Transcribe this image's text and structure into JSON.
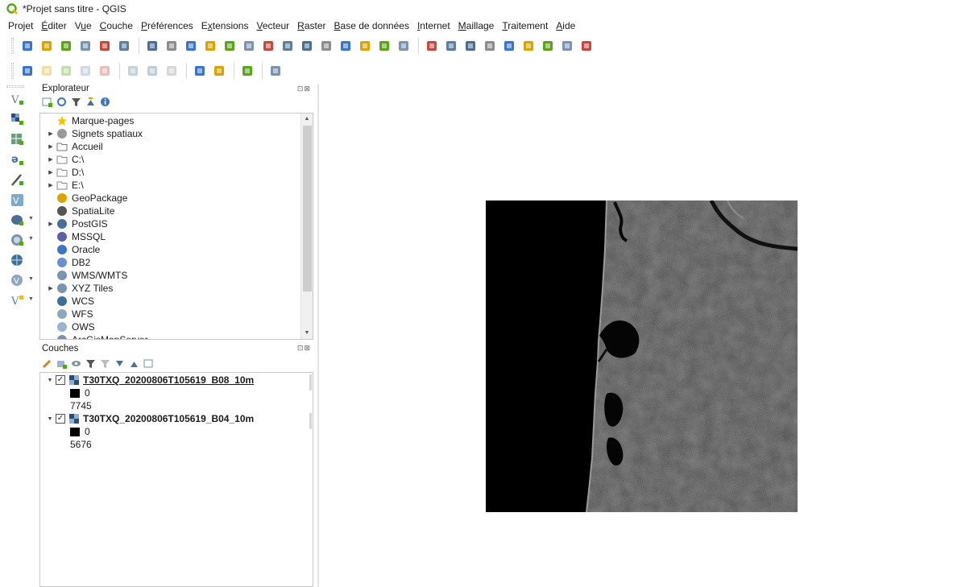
{
  "window": {
    "title": "*Projet sans titre - QGIS"
  },
  "menu": [
    {
      "u": "",
      "rest": "Projet"
    },
    {
      "u": "É",
      "rest": "diter"
    },
    {
      "u": "",
      "rest": "V",
      "u2": "u",
      "rest2": "e"
    },
    {
      "u": "C",
      "rest": "ouche"
    },
    {
      "u": "P",
      "rest": "références"
    },
    {
      "u": "",
      "rest": "E",
      "u2": "x",
      "rest2": "tensions"
    },
    {
      "u": "V",
      "rest": "ecteur"
    },
    {
      "u": "R",
      "rest": "aster"
    },
    {
      "u": "B",
      "rest": "ase de données"
    },
    {
      "u": "I",
      "rest": "nternet"
    },
    {
      "u": "M",
      "rest": "aillage"
    },
    {
      "u": "T",
      "rest": "raitement"
    },
    {
      "u": "A",
      "rest": "ide"
    }
  ],
  "toolbar1_icons": [
    "new-project-icon",
    "open-project-icon",
    "save-project-icon",
    "save-as-icon",
    "new-print-layout-icon",
    "style-manager-icon",
    "pan-icon",
    "pan-to-selection-icon",
    "zoom-in-icon",
    "zoom-out-icon",
    "zoom-full-icon",
    "zoom-to-selection-icon",
    "zoom-to-layer-icon",
    "zoom-native-icon",
    "zoom-last-icon",
    "zoom-next-icon",
    "new-bookmark-icon",
    "show-bookmarks-icon",
    "new-map-view-icon",
    "refresh-icon",
    "identify-icon",
    "select-icon",
    "deselect-icon",
    "open-attribute-table-icon",
    "field-calculator-icon",
    "statistics-icon",
    "measure-icon",
    "annotation-icon",
    "text-annotation-icon"
  ],
  "toolbar2_icons": [
    "digitize-icon",
    "edit-icon",
    "add-point-icon",
    "add-line-icon",
    "add-polygon-icon",
    "save-edits-icon",
    "undo-icon",
    "redo-icon",
    "label-icon",
    "diagram-icon",
    "python-icon",
    "help-icon"
  ],
  "explorer": {
    "title": "Explorateur",
    "controls": "⊡⊠",
    "items": [
      {
        "label": "Marque-pages",
        "icon": "star-icon",
        "expandable": false
      },
      {
        "label": "Signets spatiaux",
        "icon": "spatial-bookmarks-icon",
        "expandable": true
      },
      {
        "label": "Accueil",
        "icon": "home-folder-icon",
        "expandable": true
      },
      {
        "label": "C:\\",
        "icon": "folder-icon",
        "expandable": true
      },
      {
        "label": "D:\\",
        "icon": "folder-icon",
        "expandable": true
      },
      {
        "label": "E:\\",
        "icon": "folder-icon",
        "expandable": true
      },
      {
        "label": "GeoPackage",
        "icon": "geopackage-icon",
        "expandable": false
      },
      {
        "label": "SpatiaLite",
        "icon": "spatialite-icon",
        "expandable": false
      },
      {
        "label": "PostGIS",
        "icon": "postgis-icon",
        "expandable": true
      },
      {
        "label": "MSSQL",
        "icon": "mssql-icon",
        "expandable": false
      },
      {
        "label": "Oracle",
        "icon": "oracle-icon",
        "expandable": false
      },
      {
        "label": "DB2",
        "icon": "db2-icon",
        "expandable": false
      },
      {
        "label": "WMS/WMTS",
        "icon": "wms-icon",
        "expandable": false
      },
      {
        "label": "XYZ Tiles",
        "icon": "xyz-tiles-icon",
        "expandable": true
      },
      {
        "label": "WCS",
        "icon": "wcs-icon",
        "expandable": false
      },
      {
        "label": "WFS",
        "icon": "wfs-icon",
        "expandable": false
      },
      {
        "label": "OWS",
        "icon": "ows-icon",
        "expandable": false
      },
      {
        "label": "ArcGisMapServer",
        "icon": "arcgis-icon",
        "expandable": false
      }
    ]
  },
  "layers": {
    "title": "Couches",
    "controls": "⊡⊠",
    "items": [
      {
        "name": "T30TXQ_20200806T105619_B08_10m",
        "checked": "✓",
        "min": "0",
        "max": "7745"
      },
      {
        "name": "T30TXQ_20200806T105619_B04_10m",
        "checked": "✓",
        "min": "0",
        "max": "5676"
      }
    ]
  },
  "colors": {
    "qgis_green": "#58a51b",
    "toolbar_blue": "#3a76c4",
    "raster_bg": "#000000"
  }
}
